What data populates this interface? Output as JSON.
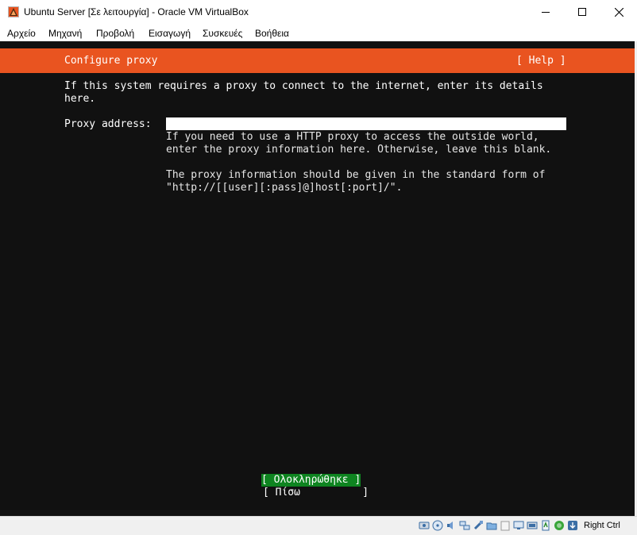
{
  "window": {
    "title": "Ubuntu Server [Σε λειτουργία] - Oracle VM VirtualBox",
    "controls": [
      "minimize",
      "maximize",
      "close"
    ]
  },
  "menu": {
    "items": [
      "Αρχείο",
      "Μηχανή",
      "Προβολή",
      "Εισαγωγή",
      "Συσκευές",
      "Βοήθεια"
    ]
  },
  "installer": {
    "header_title": "Configure proxy",
    "help_label": "[ Help ]",
    "intro_text": "If this system requires a proxy to connect to the internet, enter its details\nhere.",
    "proxy_label": "Proxy address:",
    "proxy_value": "",
    "help_text": "If you need to use a HTTP proxy to access the outside world,\nenter the proxy information here. Otherwise, leave this blank.\n\nThe proxy information should be given in the standard form of\n\"http://[[user][:pass]@]host[:port]/\".",
    "done_button": "[ Ολοκληρώθηκε ]",
    "back_button": "[ Πίσω          ]"
  },
  "colors": {
    "accent": "#e95420",
    "done_button_bg": "#0e8420",
    "screen_bg": "#111111"
  },
  "statusbar": {
    "icons": [
      "hard-disk-icon",
      "optical-drive-icon",
      "audio-icon",
      "network-icon",
      "usb-icon",
      "shared-folders-icon",
      "display-icon",
      "recording-icon",
      "cpu-icon",
      "mouse-integration-icon",
      "keyboard-icon"
    ],
    "host_key": "Right Ctrl"
  }
}
